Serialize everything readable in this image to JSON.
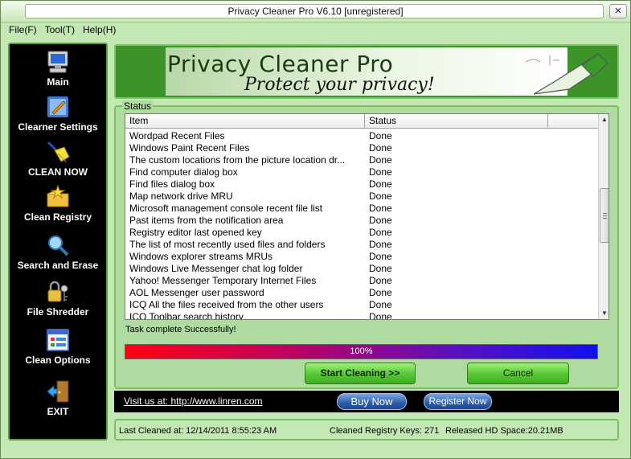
{
  "window": {
    "title": "Privacy Cleaner Pro V6.10 [unregistered]",
    "close_glyph": "×"
  },
  "menu": [
    "File(F)",
    "Tool(T)",
    "Help(H)"
  ],
  "sidebar": {
    "items": [
      {
        "label": "Main",
        "icon": "computer-icon"
      },
      {
        "label": "Clearner Settings",
        "icon": "settings-wrench-icon"
      },
      {
        "label": "CLEAN NOW",
        "icon": "broom-icon"
      },
      {
        "label": "Clean Registry",
        "icon": "registry-folder-icon"
      },
      {
        "label": "Search and  Erase",
        "icon": "magnifier-icon"
      },
      {
        "label": "File Shredder",
        "icon": "lock-key-icon"
      },
      {
        "label": "Clean Options",
        "icon": "options-window-icon"
      },
      {
        "label": "EXIT",
        "icon": "exit-door-icon"
      }
    ]
  },
  "banner": {
    "title": "Privacy Cleaner Pro",
    "subtitle": "Protect your privacy!"
  },
  "status": {
    "legend": "Status",
    "columns": [
      "Item",
      "Status"
    ],
    "rows": [
      [
        "Wordpad Recent Files",
        "Done"
      ],
      [
        "Windows Paint Recent Files",
        "Done"
      ],
      [
        "The custom locations from the picture location dr...",
        "Done"
      ],
      [
        "Find computer dialog box",
        "Done"
      ],
      [
        "Find files dialog box",
        "Done"
      ],
      [
        "Map network drive MRU",
        "Done"
      ],
      [
        "Microsoft management console recent file list",
        "Done"
      ],
      [
        "Past items from the notification area",
        "Done"
      ],
      [
        "Registry editor last opened key",
        "Done"
      ],
      [
        "The list of most recently used files and folders",
        "Done"
      ],
      [
        "Windows explorer streams MRUs",
        "Done"
      ],
      [
        "Windows Live Messenger chat log folder",
        "Done"
      ],
      [
        "Yahoo! Messenger Temporary Internet Files",
        "Done"
      ],
      [
        "AOL Messenger user password",
        "Done"
      ],
      [
        "ICQ All the files received from the other users",
        "Done"
      ],
      [
        "ICQ Toolbar search history",
        "Done"
      ]
    ],
    "message": "Task complete Successfully!",
    "progress_label": "100%",
    "progress_value": 1.0
  },
  "buttons": {
    "start": "Start Cleaning >>",
    "cancel": "Cancel",
    "buy": "Buy Now",
    "register": "Register Now"
  },
  "link": {
    "text": "Visit us at: http://www.linren.com"
  },
  "footer": {
    "last_cleaned": "Last Cleaned at:   12/14/2011  8:55:23 AM",
    "registry_keys": "Cleaned Registry Keys: 271",
    "hd_space": "Released HD Space:20.21MB"
  },
  "colors": {
    "accent_green": "#58a03c",
    "progress_start": "#ff0010",
    "progress_end": "#1010f0"
  }
}
